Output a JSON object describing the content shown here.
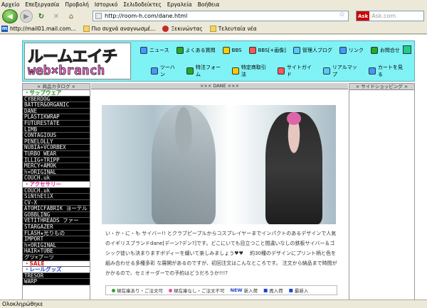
{
  "menubar": [
    "Αρχείο",
    "Επεξεργασία",
    "Προβολή",
    "Ιστορικό",
    "Σελιδοδείκτες",
    "Εργαλεία",
    "Βοήθεια"
  ],
  "url": "http://room-h.com/dane.html",
  "search_placeholder": "Ask.com",
  "bookmarks": [
    "http://mail01.mail.com...",
    "Πιο συχνά αναγνωσμέ...",
    "Ξεκινώντας",
    "Τελευταία νέα"
  ],
  "status": "Ολοκληρώθηκε",
  "header": {
    "logo_jp": "ルームエイチ",
    "logo_en": "web×branch",
    "nav_row1": [
      "ニュース",
      "よくある質問",
      "BBS",
      "BBS[+画像]",
      "管理人ブログ",
      "リンク",
      "お問合せ"
    ],
    "nav_row2": [
      "ツーハン",
      "特注フォーム",
      "特定商取引法",
      "サイトガイド",
      "リアルマップ",
      "カートを見る"
    ]
  },
  "left_col": {
    "title": "× 商品カタログ ×",
    "items": [
      {
        "label": "・サップウェア",
        "type": "sec green"
      },
      {
        "label": "CYBERDOG",
        "type": "cat"
      },
      {
        "label": "BATTER&ORGANIC",
        "type": "cat"
      },
      {
        "label": "DANE",
        "type": "cat"
      },
      {
        "label": "PLASTIKWRAP",
        "type": "cat"
      },
      {
        "label": "FUTURESTATE",
        "type": "cat"
      },
      {
        "label": "LIMB",
        "type": "cat"
      },
      {
        "label": "CONTAGIOUS",
        "type": "cat"
      },
      {
        "label": "PENELOLLY",
        "type": "cat"
      },
      {
        "label": "NUBIA+VCORBEX",
        "type": "cat"
      },
      {
        "label": "TURBO WEAR",
        "type": "cat"
      },
      {
        "label": "ILLIG+TRIPP",
        "type": "cat"
      },
      {
        "label": "MERCY+AMOK",
        "type": "cat"
      },
      {
        "label": "h×ORIGINAL",
        "type": "cat"
      },
      {
        "label": "COUCH.uk",
        "type": "cat"
      },
      {
        "label": "・アクセサリー",
        "type": "sec"
      },
      {
        "label": "COUCH.uk",
        "type": "cat"
      },
      {
        "label": "SiNthEtiX",
        "type": "cat"
      },
      {
        "label": "CV-X",
        "type": "cat"
      },
      {
        "label": "ATOMICFABRIK ヨーテル",
        "type": "cat"
      },
      {
        "label": "GOBBLING",
        "type": "cat"
      },
      {
        "label": "VETITHREADS ファー",
        "type": "cat"
      },
      {
        "label": "STARGAZER",
        "type": "cat"
      },
      {
        "label": "FLASH★光りもの",
        "type": "cat"
      },
      {
        "label": "IMPORT",
        "type": "cat"
      },
      {
        "label": "h×ORIGINAL",
        "type": "cat"
      },
      {
        "label": "HAIR×TUBE",
        "type": "cat"
      },
      {
        "label": "グツ×ブーツ",
        "type": "cat"
      },
      {
        "label": "・SALE",
        "type": "sec red"
      },
      {
        "label": "・レールグッズ",
        "type": "sec blue"
      },
      {
        "label": "TRESOR",
        "type": "cat"
      },
      {
        "label": "WARP",
        "type": "cat"
      }
    ]
  },
  "center_head": "××× DANE ×××",
  "right_col": {
    "title": "× サイドショッピング ×"
  },
  "description": "い・か・に・も サイバー!! とクラブピープルからコスプレイヤーまでインパクトのあるデザインで人気のイギリスブランドdane[デーン?デン?]です。どこにいても目立つこと間違いなしの鉄板サイバー＆ゴシック徒いも決まりますボディーを纏いて楽しみましょう♥♥ 　約30種のデザインにプリント柄と色を組み合わせる多種多彩 な展開があるのですが、初回注文はこんなところです。 注文から納品まで時間がかかるので、セミオーダーでの予約はどうだろうか!!!?",
  "legend": {
    "in_stock": "現在庫あり・ご注文可",
    "out_stock": "現在庫なし・ご注文不可",
    "new_label": "NEW",
    "new_text": "新入荷",
    "arrival_mark": "■",
    "arrival_text": "再入荷",
    "reserve_mark": "■",
    "reserve_text": "最新入"
  }
}
